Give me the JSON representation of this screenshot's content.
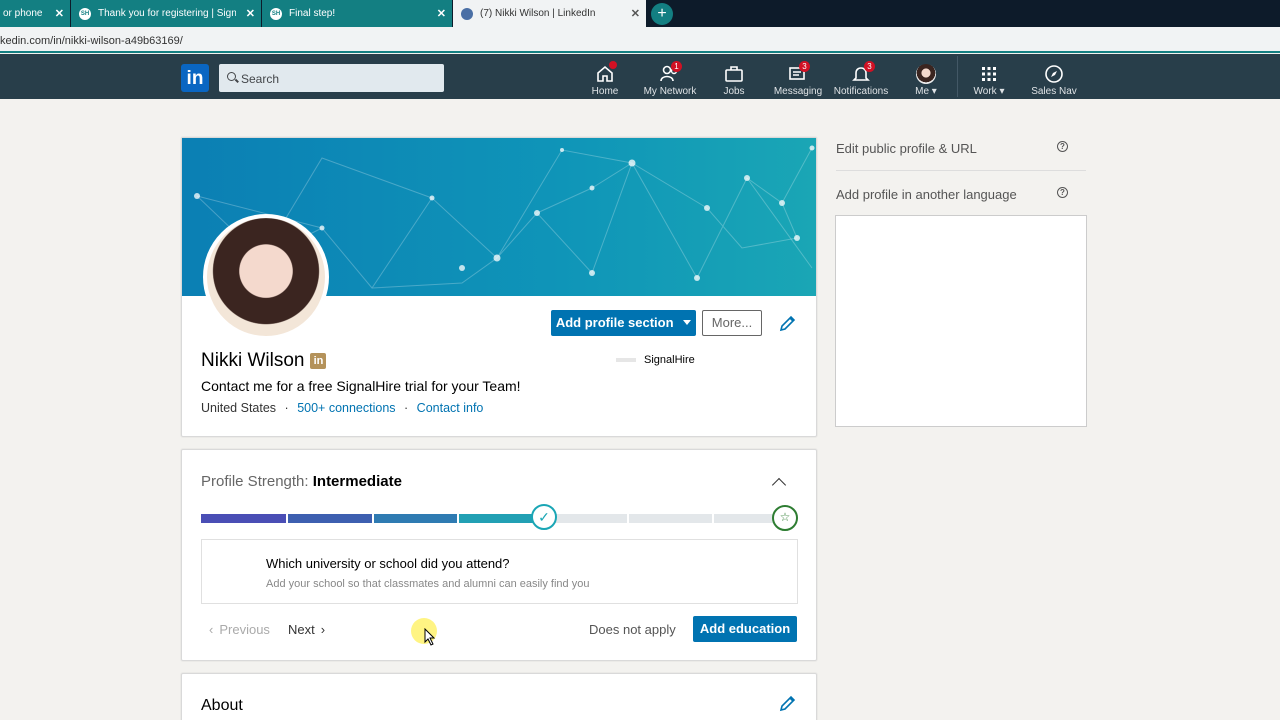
{
  "browser": {
    "tabs": [
      {
        "title": "or phone",
        "favicon": ""
      },
      {
        "title": "Thank you for registering | SignalHire",
        "favicon": "SH"
      },
      {
        "title": "Final step!",
        "favicon": "SH"
      },
      {
        "title": "(7) Nikki Wilson | LinkedIn",
        "favicon": ""
      }
    ],
    "close_glyph": "✕",
    "new_tab_glyph": "+",
    "url": "kedin.com/in/nikki-wilson-a49b63169/"
  },
  "nav": {
    "logo": "in",
    "search_placeholder": "Search",
    "items": [
      {
        "label": "Home",
        "badge": ""
      },
      {
        "label": "My Network",
        "badge": "1"
      },
      {
        "label": "Jobs",
        "badge": ""
      },
      {
        "label": "Messaging",
        "badge": "3"
      },
      {
        "label": "Notifications",
        "badge": "3"
      },
      {
        "label": "Me ▾",
        "badge": ""
      },
      {
        "label": "Work ▾",
        "badge": ""
      },
      {
        "label": "Sales Nav",
        "badge": ""
      }
    ],
    "accent": "#283e4a"
  },
  "profile": {
    "add_section_label": "Add profile section",
    "more_label": "More...",
    "name": "Nikki Wilson",
    "linkedin_badge": "in",
    "headline": "Contact me for a free SignalHire trial for your Team!",
    "location": "United States",
    "connections": "500+ connections",
    "contact_info": "Contact info",
    "separator": "·",
    "company": "SignalHire"
  },
  "strength": {
    "label": "Profile Strength: ",
    "level": "Intermediate",
    "progress_steps_filled": 4,
    "progress_steps_total": 7,
    "check_glyph": "✓",
    "star_glyph": "☆",
    "question": "Which university or school did you attend?",
    "subtext": "Add your school so that classmates and alumni can easily find you",
    "previous_label": "Previous",
    "next_label": "Next",
    "does_not_apply_label": "Does not apply",
    "add_education_label": "Add education"
  },
  "about": {
    "title": "About"
  },
  "sidebar": {
    "edit_public_profile": "Edit public profile & URL",
    "add_language": "Add profile in another language",
    "help_glyph": "?"
  },
  "colors": {
    "primary_blue": "#0073b1",
    "progress": [
      "#4a4eb5",
      "#3d5fb0",
      "#2f7bb2",
      "#22a0b4",
      "#e3e7ea",
      "#e3e7ea",
      "#e3e7ea"
    ]
  }
}
